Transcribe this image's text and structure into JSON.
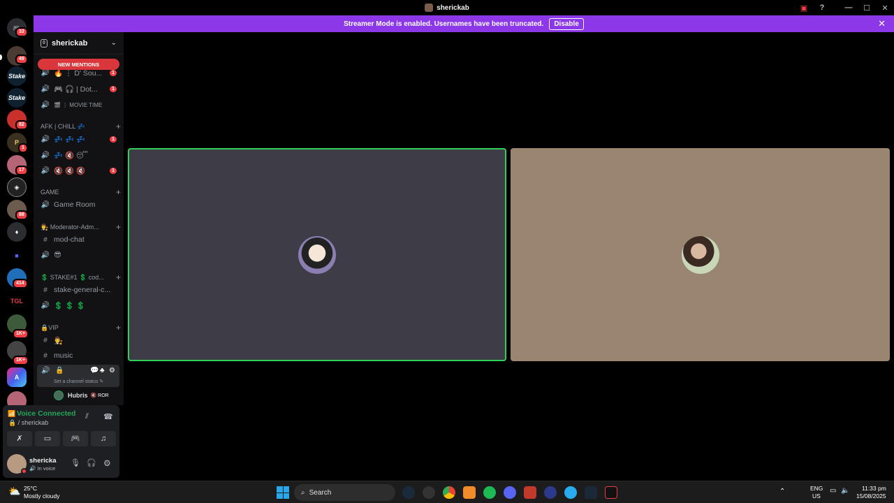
{
  "window": {
    "title": "sherickab",
    "controls": [
      "—",
      "☐",
      "✕"
    ]
  },
  "banner": {
    "text": "Streamer Mode is enabled. Usernames have been truncated.",
    "button": "Disable"
  },
  "servers": [
    {
      "name": "discord-home",
      "badge": "33"
    },
    {
      "name": "server-2",
      "badge": "49"
    },
    {
      "name": "stake-1",
      "badge": ""
    },
    {
      "name": "stake-2",
      "badge": ""
    },
    {
      "name": "server-5",
      "badge": "82"
    },
    {
      "name": "server-6",
      "badge": "1"
    },
    {
      "name": "server-7",
      "badge": "17"
    },
    {
      "name": "server-8",
      "badge": ""
    },
    {
      "name": "server-9",
      "badge": "88"
    },
    {
      "name": "server-10",
      "badge": ""
    },
    {
      "name": "server-11",
      "badge": ""
    },
    {
      "name": "server-12",
      "badge": "414"
    },
    {
      "name": "server-13",
      "badge": ""
    },
    {
      "name": "server-14",
      "badge": "1K+"
    },
    {
      "name": "server-15",
      "badge": "1K+"
    },
    {
      "name": "server-16",
      "badge": ""
    },
    {
      "name": "server-17",
      "badge": ""
    }
  ],
  "guild": {
    "name": "sherickab",
    "zero": "0"
  },
  "new_mentions": "NEW MENTIONS",
  "channels": {
    "top": [
      {
        "label": "🔥 ⋮ D' Sou...",
        "badge": "1"
      },
      {
        "label": "🎮 🎧 | Dot...",
        "badge": "1"
      },
      {
        "label": "🎬 ⋮ MOVIE TIME",
        "badge": ""
      }
    ],
    "afk_cat": "AFK | CHILL 💤",
    "afk": [
      {
        "label": "💤 💤 💤",
        "badge": "1"
      },
      {
        "label": "💤 🔇 😴",
        "badge": ""
      },
      {
        "label": "🔇 🔇 🔇",
        "badge": "1"
      }
    ],
    "game_cat": "GAME",
    "game": [
      {
        "label": "Game Room"
      }
    ],
    "mod_cat": "👨‍⚖️ Moderator-Adm...",
    "mod": [
      {
        "label": "mod-chat"
      },
      {
        "label": "😎"
      }
    ],
    "stake_cat": "💲 STAKE#1 💲 cod...",
    "stake": [
      {
        "label": "stake-general-c..."
      },
      {
        "label": "💲 💲 💲"
      }
    ],
    "vip_cat": "🔒VIP",
    "vip": [
      {
        "label": "👨‍⚖️"
      },
      {
        "label": "music"
      }
    ],
    "active": {
      "label": "🔒",
      "status": "Set a channel status ✎"
    },
    "member": {
      "name": "Hubris",
      "tag": "🔇 ROR"
    }
  },
  "voice": {
    "status": "Voice Connected",
    "channel": "🔒 / sherickab"
  },
  "user": {
    "name": "shericka",
    "status": "🔊 In voice"
  },
  "taskbar": {
    "weather_temp": "25°C",
    "weather_desc": "Mostly cloudy",
    "search": "Search",
    "lang": "ENG",
    "region": "US",
    "time": "11:33 pm",
    "date": "15/08/2025"
  },
  "colors": {
    "banner": "#8c38e8",
    "tile_left": "#3e3d47",
    "tile_right": "#9a8571",
    "speaking": "#2fd05a",
    "voice_green": "#23a55a",
    "badge": "#f23f43"
  }
}
